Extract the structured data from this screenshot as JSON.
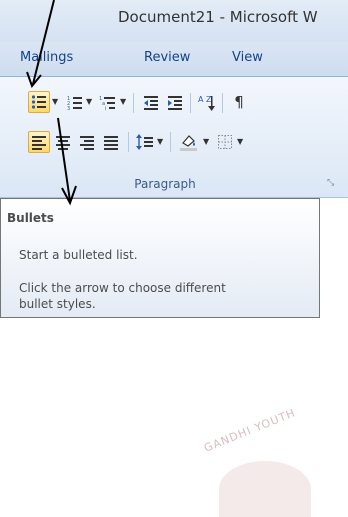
{
  "window": {
    "title": "Document21  -  Microsoft W"
  },
  "tabs": [
    {
      "label": "Mailings"
    },
    {
      "label": "Review"
    },
    {
      "label": "View"
    }
  ],
  "toolbar": {
    "row1": [
      "bullets-icon",
      "numbering-icon",
      "multilevel-list-icon",
      "decrease-indent-icon",
      "increase-indent-icon",
      "sort-icon",
      "show-formatting-marks-icon"
    ],
    "row2": [
      "align-left-icon",
      "center-icon",
      "align-right-icon",
      "justify-icon",
      "line-spacing-icon",
      "shading-icon",
      "borders-icon"
    ],
    "sort_glyph": "A Z",
    "pilcrow": "¶",
    "active_button": "bullets-icon"
  },
  "group": {
    "label": "Paragraph",
    "launcher": "⤡"
  },
  "tooltip": {
    "title": "Bullets",
    "line1": "Start a bulleted list.",
    "line2": "Click the arrow to choose different",
    "line3": "bullet styles."
  },
  "watermark": {
    "text": "GANDHI YOUTH"
  },
  "colors": {
    "accent": "#ffd86a",
    "tab_text": "#15428b",
    "annotation": "#000000"
  }
}
